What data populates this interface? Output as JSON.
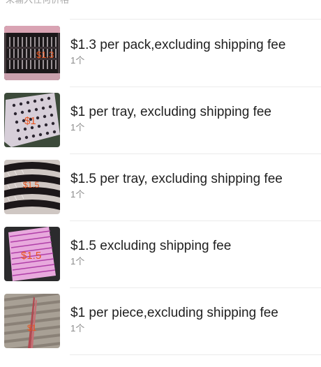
{
  "hint": "未输入任何价格",
  "items": [
    {
      "title": "$1.3 per pack,excluding shipping fee",
      "qty": "1个",
      "price_overlay": "$1.3",
      "thumb_icon": "eyelash-pack-photo"
    },
    {
      "title": "$1 per tray, excluding shipping fee",
      "qty": "1个",
      "price_overlay": "$1",
      "thumb_icon": "eyelash-tray-photo"
    },
    {
      "title": "$1.5 per tray, excluding shipping fee",
      "qty": "1个",
      "price_overlay": "$1.5",
      "thumb_icon": "eyelash-strips-photo"
    },
    {
      "title": "$1.5 excluding shipping fee",
      "qty": "1个",
      "price_overlay": "$1.5",
      "thumb_icon": "pink-lash-tray-photo"
    },
    {
      "title": "$1 per piece,excluding shipping fee",
      "qty": "1个",
      "price_overlay": "$1",
      "thumb_icon": "lash-tweezer-photo"
    }
  ]
}
